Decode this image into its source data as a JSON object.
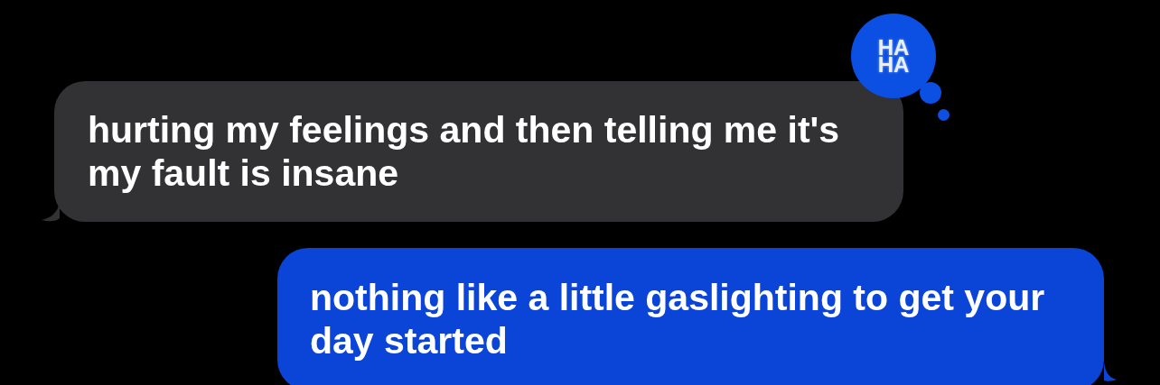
{
  "messages": [
    {
      "kind": "incoming",
      "text": "hurting my feelings and then telling me it's my fault is insane",
      "reaction": {
        "label": "HA HA"
      }
    },
    {
      "kind": "outgoing",
      "text": "nothing like a little gaslighting to get your day started"
    }
  ]
}
